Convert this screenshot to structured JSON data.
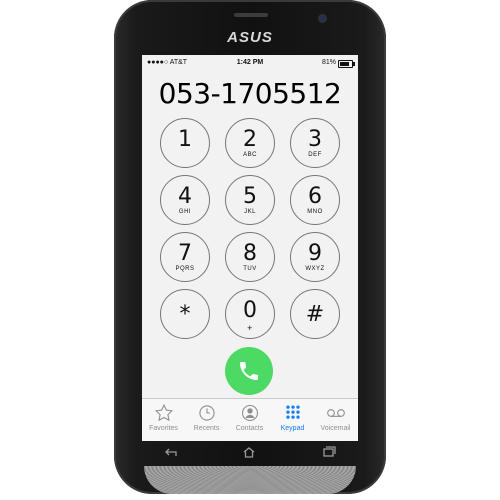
{
  "device": {
    "brand": "ASUS"
  },
  "status_bar": {
    "carrier": "●●●●○ AT&T",
    "time": "1:42 PM",
    "battery": "81%",
    "battery_level": 0.81
  },
  "dialer": {
    "number": "053-1705512",
    "keys": [
      {
        "digit": "1",
        "letters": ""
      },
      {
        "digit": "2",
        "letters": "ABC"
      },
      {
        "digit": "3",
        "letters": "DEF"
      },
      {
        "digit": "4",
        "letters": "GHI"
      },
      {
        "digit": "5",
        "letters": "JKL"
      },
      {
        "digit": "6",
        "letters": "MNO"
      },
      {
        "digit": "7",
        "letters": "PQRS"
      },
      {
        "digit": "8",
        "letters": "TUV"
      },
      {
        "digit": "9",
        "letters": "WXYZ"
      },
      {
        "digit": "*",
        "letters": ""
      },
      {
        "digit": "0",
        "letters": "+"
      },
      {
        "digit": "#",
        "letters": ""
      }
    ],
    "call_icon": "phone-icon"
  },
  "tabbar": {
    "tabs": [
      {
        "label": "Favorites",
        "icon": "star-icon"
      },
      {
        "label": "Recents",
        "icon": "clock-icon"
      },
      {
        "label": "Contacts",
        "icon": "person-icon"
      },
      {
        "label": "Keypad",
        "icon": "keypad-icon"
      },
      {
        "label": "Voicemail",
        "icon": "voicemail-icon"
      }
    ],
    "active": "Keypad",
    "active_color": "#157efb"
  },
  "colors": {
    "call_button": "#4cd964"
  }
}
